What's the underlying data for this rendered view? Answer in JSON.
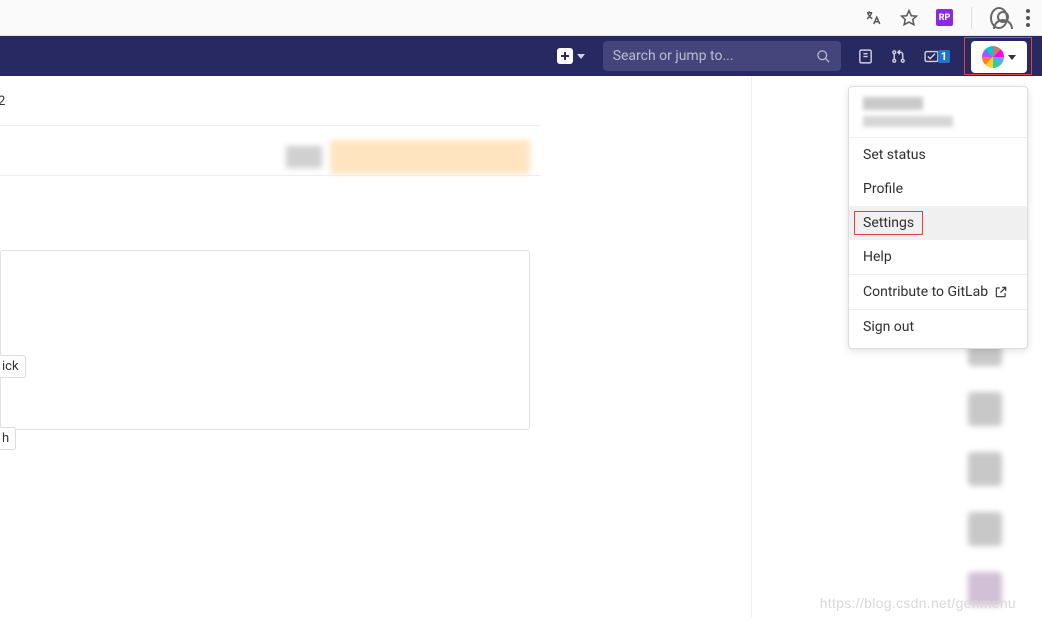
{
  "chrome": {
    "ext_label": "RP"
  },
  "nav": {
    "search_placeholder": "Search or jump to...",
    "todos_badge": "1"
  },
  "menu": {
    "items": {
      "set_status": "Set status",
      "profile": "Profile",
      "settings": "Settings",
      "help": "Help",
      "contribute": "Contribute to GitLab",
      "sign_out": "Sign out"
    }
  },
  "left": {
    "crumb_tail": "2",
    "chip1": "ick",
    "chip2": "h"
  },
  "watermark": "https://blog.csdn.net/genmenu"
}
